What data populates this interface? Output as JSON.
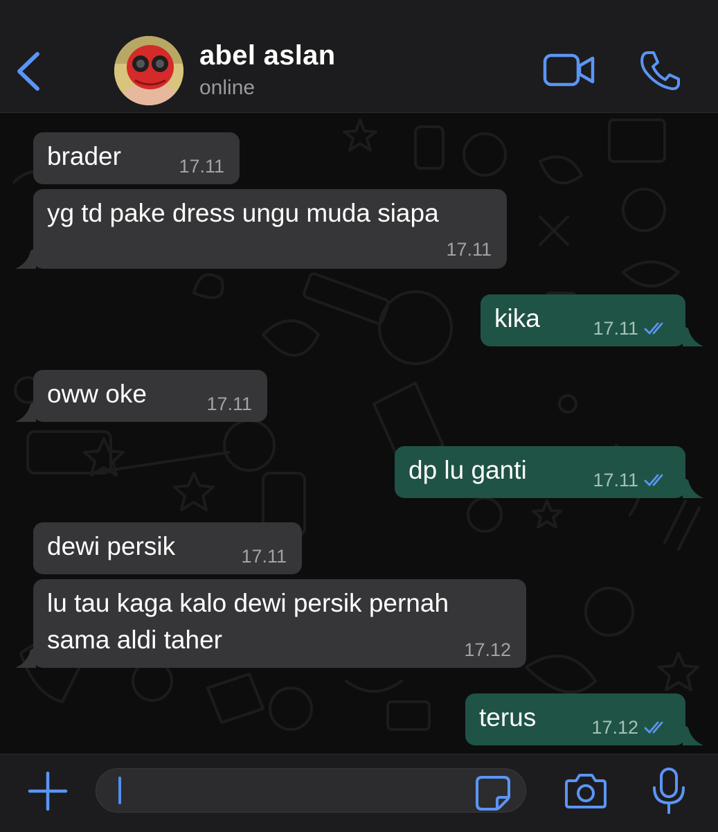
{
  "header": {
    "contact_name": "abel aslan",
    "status": "online",
    "icons": [
      "chevron-left-icon",
      "video-camera-icon",
      "phone-icon"
    ]
  },
  "colors": {
    "accent": "#5b95f5",
    "incoming_bubble": "#363638",
    "outgoing_bubble": "#1f5346",
    "read_ticks": "#5b95f5"
  },
  "messages": [
    {
      "direction": "incoming",
      "text": "brader",
      "time": "17.11"
    },
    {
      "direction": "incoming",
      "text": "yg td pake dress ungu muda siapa",
      "time": "17.11"
    },
    {
      "direction": "outgoing",
      "text": "kika",
      "time": "17.11",
      "status": "read"
    },
    {
      "direction": "incoming",
      "text": "oww oke",
      "time": "17.11"
    },
    {
      "direction": "outgoing",
      "text": "dp lu ganti",
      "time": "17.11",
      "status": "read"
    },
    {
      "direction": "incoming",
      "text": "dewi persik",
      "time": "17.11"
    },
    {
      "direction": "incoming",
      "text": "lu tau kaga kalo dewi persik pernah",
      "text_line2": "sama aldi taher",
      "time": "17.12"
    },
    {
      "direction": "outgoing",
      "text": "terus",
      "time": "17.12",
      "status": "read"
    }
  ],
  "composer": {
    "value": "",
    "placeholder": "",
    "icons": [
      "plus-icon",
      "sticker-icon",
      "camera-icon",
      "microphone-icon"
    ]
  }
}
